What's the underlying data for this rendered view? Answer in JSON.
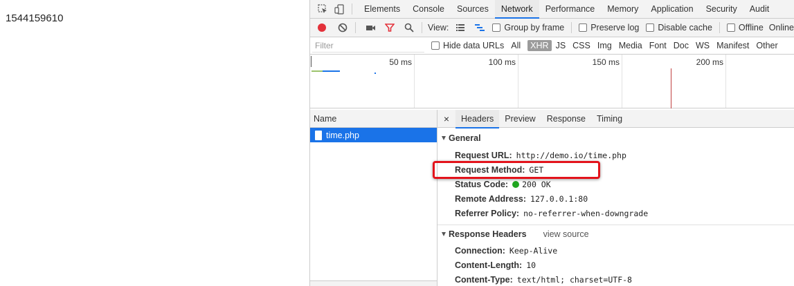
{
  "page": {
    "number_text": "1544159610"
  },
  "devtools": {
    "main_tabs": [
      "Elements",
      "Console",
      "Sources",
      "Network",
      "Performance",
      "Memory",
      "Application",
      "Security",
      "Audit"
    ],
    "active_tab": "Network",
    "toolbar": {
      "view_label": "View:",
      "group_by_frame": "Group by frame",
      "preserve_log": "Preserve log",
      "disable_cache": "Disable cache",
      "offline": "Offline",
      "online": "Online"
    },
    "filter": {
      "placeholder": "Filter",
      "hide_data_urls": "Hide data URLs",
      "types": [
        "All",
        "XHR",
        "JS",
        "CSS",
        "Img",
        "Media",
        "Font",
        "Doc",
        "WS",
        "Manifest",
        "Other"
      ],
      "active_type": "XHR"
    },
    "timeline": {
      "ticks": [
        "50 ms",
        "100 ms",
        "150 ms",
        "200 ms"
      ]
    },
    "requests": {
      "column_name": "Name",
      "items": [
        {
          "name": "time.php"
        }
      ]
    },
    "detail": {
      "tabs": [
        "Headers",
        "Preview",
        "Response",
        "Timing"
      ],
      "active_tab": "Headers",
      "general": {
        "title": "General",
        "rows": [
          {
            "key": "Request URL:",
            "value": "http://demo.io/time.php"
          },
          {
            "key": "Request Method:",
            "value": "GET"
          },
          {
            "key": "Status Code:",
            "value": "200 OK"
          },
          {
            "key": "Remote Address:",
            "value": "127.0.0.1:80"
          },
          {
            "key": "Referrer Policy:",
            "value": "no-referrer-when-downgrade"
          }
        ]
      },
      "response_headers": {
        "title": "Response Headers",
        "view_source": "view source",
        "rows": [
          {
            "key": "Connection:",
            "value": "Keep-Alive"
          },
          {
            "key": "Content-Length:",
            "value": "10"
          },
          {
            "key": "Content-Type:",
            "value": "text/html; charset=UTF-8"
          }
        ]
      }
    },
    "colors": {
      "accent": "#1a73e8",
      "record": "#e3313a",
      "status_ok": "#20a620",
      "highlight": "#e3131b"
    }
  }
}
